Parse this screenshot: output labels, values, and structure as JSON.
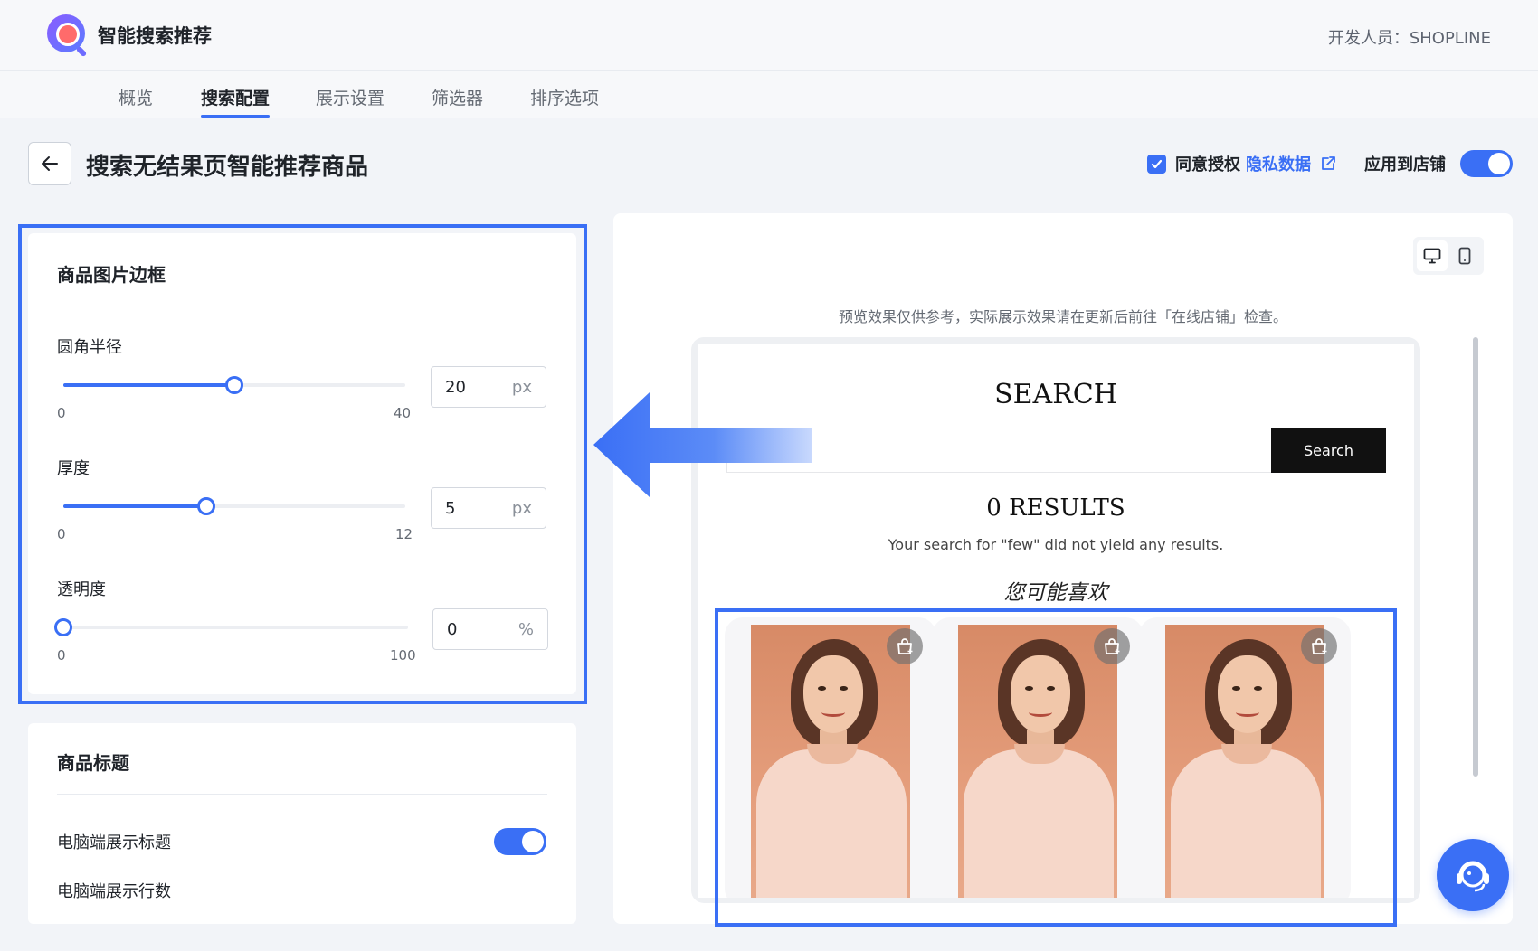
{
  "app": {
    "title": "智能搜索推荐",
    "developer": "开发人员：SHOPLINE"
  },
  "nav": {
    "tabs": [
      "概览",
      "搜索配置",
      "展示设置",
      "筛选器",
      "排序选项"
    ],
    "active": "搜索配置"
  },
  "page": {
    "title": "搜索无结果页智能推荐商品",
    "consent_label": "同意授权",
    "privacy_link": "隐私数据",
    "apply_label": "应用到店铺",
    "consent_checked": true,
    "apply_enabled": true
  },
  "border_card": {
    "title": "商品图片边框",
    "radius": {
      "label": "圆角半径",
      "value": "20",
      "unit": "px",
      "min": "0",
      "max": "40"
    },
    "thickness": {
      "label": "厚度",
      "value": "5",
      "unit": "px",
      "min": "0",
      "max": "12"
    },
    "opacity": {
      "label": "透明度",
      "value": "0",
      "unit": "%",
      "min": "0",
      "max": "100"
    }
  },
  "title_card": {
    "title": "商品标题",
    "desktop_show_title": "电脑端展示标题",
    "desktop_show_title_enabled": true,
    "desktop_rows": "电脑端展示行数"
  },
  "preview": {
    "note": "预览效果仅供参考，实际展示效果请在更新后前往「在线店铺」检查。",
    "active_device": "desktop",
    "store": {
      "heading": "SEARCH",
      "search_button": "Search",
      "results_title": "0 RESULTS",
      "results_message": "Your search for \"few\" did not yield any results.",
      "recommend_title": "您可能喜欢",
      "product_count": 3
    }
  },
  "colors": {
    "accent": "#3a6ff5",
    "text": "#1f2329",
    "muted": "#646a73",
    "background": "#f2f4f8"
  }
}
